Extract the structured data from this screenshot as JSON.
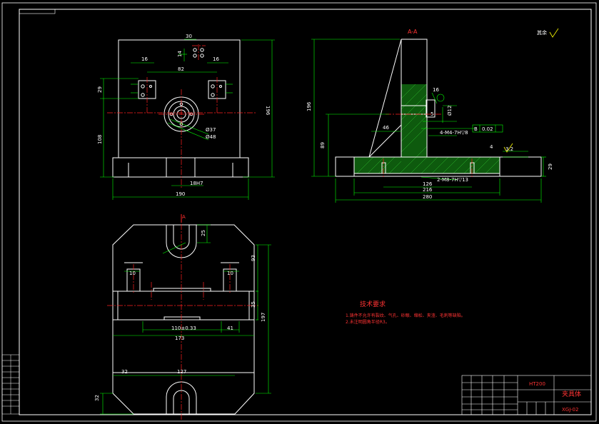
{
  "colors": {
    "background": "#000000",
    "outline": "#ffffff",
    "dimension": "#00ff00",
    "centerline": "#ff2020",
    "hatch": "#22aa22",
    "title": "#ff3030",
    "yellow": "#ffff00"
  },
  "front_view": {
    "dims": {
      "d30": "30",
      "d16a": "16",
      "d16b": "16",
      "d14": "14",
      "d82": "82",
      "d29": "29",
      "d108": "108",
      "d196": "196",
      "d37": "Ø37",
      "d48": "Ø48",
      "d18h7": "18H7",
      "d190": "190"
    }
  },
  "section_view": {
    "title": "A-A",
    "roughness_note": "其余",
    "dims": {
      "d196": "196",
      "d89": "89",
      "d46": "46",
      "d4": "4",
      "d32": "3.2",
      "d29": "29",
      "d126": "126",
      "d216": "216",
      "d280": "280",
      "hole1": "2-M8-7H▽13",
      "hole2": "4-M4-7H▽8",
      "tol": "0.02",
      "d12": "Ø12",
      "datum": "B",
      "r16": "16",
      "r5": "5"
    }
  },
  "top_view": {
    "section_mark": "A",
    "dims": {
      "d25": "25",
      "d93": "93",
      "d35": "35",
      "d197": "197",
      "d10a": "10",
      "d10b": "10",
      "d110": "110±0.33",
      "d41": "41",
      "d173": "173",
      "d32a": "32",
      "d127": "127",
      "d32b": "32"
    }
  },
  "technical_requirements": {
    "heading": "技术要求",
    "items": [
      "1.铸件不允许有裂纹、气孔、砂眼、缩松、夹渣、毛刺等缺陷。",
      "2.未注明圆角半径R3。"
    ]
  },
  "title_block": {
    "material": "HT200",
    "part_name": "夹具体",
    "drawing_no": "XGJ-02"
  }
}
